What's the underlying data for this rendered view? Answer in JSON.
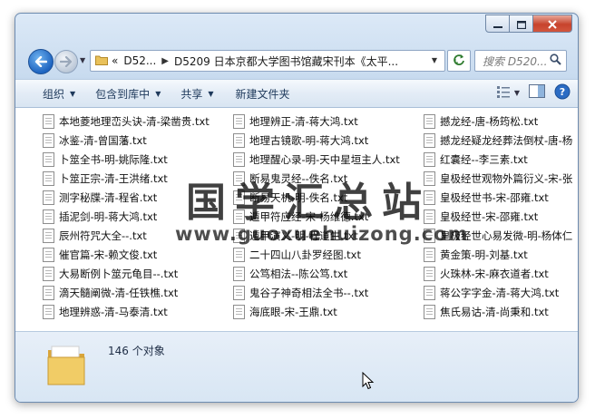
{
  "titlebar": {
    "controls": {
      "minimize": "—",
      "maximize": "☐",
      "close": "✕"
    }
  },
  "nav": {
    "breadcrumb_prefix": "«",
    "breadcrumb": [
      "D52...",
      "D5209 日本京都大学图书馆藏宋刊本《太平..."
    ],
    "search_placeholder": "搜索 D520..."
  },
  "toolbar": {
    "organize": "组织",
    "include_library": "包含到库中",
    "share": "共享",
    "new_folder": "新建文件夹"
  },
  "files": {
    "columns": [
      [
        "本地菱地理峦头诀-清-梁凿贵.txt",
        "冰鉴-清-曾国藩.txt",
        "卜筮全书-明-姚际隆.txt",
        "卜筮正宗-清-王洪绪.txt",
        "测字秘牒-清-程省.txt",
        "插泥剑-明-蒋大鸿.txt",
        "辰州符咒大全--.txt",
        "催官篇-宋-赖文俊.txt",
        "大易断例卜筮元龟目--.txt",
        "滴天髓阐微-清-任铁樵.txt",
        "地理辨惑-清-马泰清.txt"
      ],
      [
        "地理辨正-清-蒋大鸿.txt",
        "地理古镜歌-明-蒋大鸿.txt",
        "地理醒心录-明-天中星垣主人.txt",
        "断易鬼灵经--佚名.txt",
        "断易天机-明-佚名.txt",
        "遁甲符应经-宋-杨维德.txt",
        "遁甲演义-明-程道生.txt",
        "二十四山八卦罗经图.txt",
        "公笃相法--陈公笃.txt",
        "鬼谷子神奇相法全书--.txt",
        "海底眼-宋-王鼎.txt"
      ],
      [
        "撼龙经-唐-杨筠松.txt",
        "撼龙经疑龙经葬法倒杖-唐-杨",
        "红囊经--李三素.txt",
        "皇极经世观物外篇衍义-宋-张",
        "皇极经世书-宋-邵雍.txt",
        "皇极经世-宋-邵雍.txt",
        "皇极经世心易发微-明-杨体仁",
        "黄金策-明-刘基.txt",
        "火珠林-宋-麻衣道者.txt",
        "蒋公字字金-清-蒋大鸿.txt",
        "焦氏易诂-清-尚秉和.txt"
      ]
    ]
  },
  "status": {
    "count_text": "146 个对象"
  },
  "watermark": {
    "title": "国学汇总站",
    "url": "www.guoxuehuizong.com"
  },
  "colors": {
    "accent": "#1e64c0",
    "toolbar_text": "#1e395b",
    "folder": "#e9c15a"
  }
}
